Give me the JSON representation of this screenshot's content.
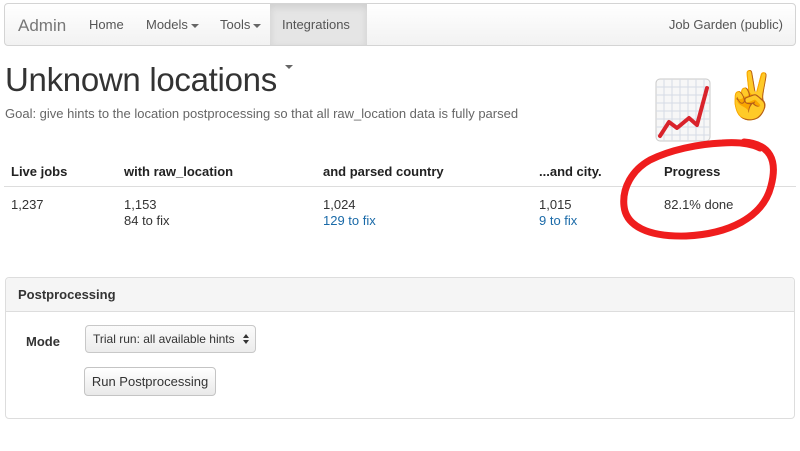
{
  "navbar": {
    "brand": "Admin",
    "items": [
      {
        "label": "Home",
        "dropdown": false,
        "active": false
      },
      {
        "label": "Models",
        "dropdown": true,
        "active": false
      },
      {
        "label": "Tools",
        "dropdown": true,
        "active": false
      },
      {
        "label": "Integrations",
        "dropdown": true,
        "active": true
      }
    ],
    "right_label": "Job Garden (public)"
  },
  "page": {
    "title": "Unknown locations",
    "goal": "Goal: give hints to the location postprocessing so that all raw_location data is fully parsed"
  },
  "stats": {
    "headers": [
      "Live jobs",
      "with raw_location",
      "and parsed country",
      "...and city.",
      "Progress"
    ],
    "live_jobs": "1,237",
    "raw_location": {
      "count": "1,153",
      "to_fix": "84 to fix"
    },
    "parsed_country": {
      "count": "1,024",
      "to_fix": "129 to fix"
    },
    "parsed_city": {
      "count": "1,015",
      "to_fix": "9 to fix"
    },
    "progress": "82.1% done"
  },
  "stickers": {
    "chart": "chart-increasing-emoji",
    "peace": "✌️"
  },
  "postprocessing": {
    "heading": "Postprocessing",
    "mode_label": "Mode",
    "mode_selected": "Trial run: all available hints",
    "run_button": "Run Postprocessing"
  },
  "colors": {
    "link": "#1a6aa8",
    "annotation_circle": "#ee1111",
    "chart_line": "#d9232b"
  }
}
